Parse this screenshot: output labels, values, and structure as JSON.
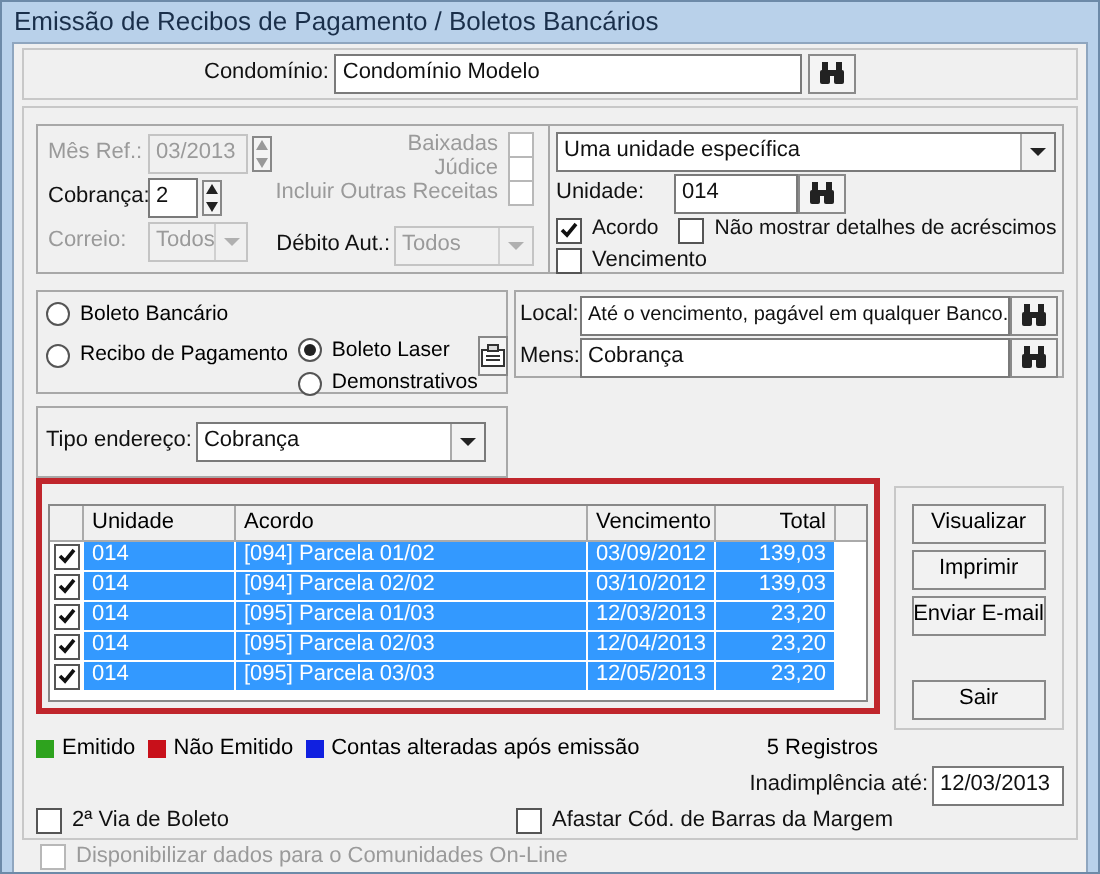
{
  "window": {
    "title": "Emissão de Recibos de Pagamento / Boletos Bancários"
  },
  "condominio": {
    "label": "Condomínio:",
    "value": "Condomínio Modelo"
  },
  "filters": {
    "mes_ref": {
      "label": "Mês Ref.:",
      "value": "03/2013",
      "disabled": true
    },
    "cobranca": {
      "label": "Cobrança:",
      "value": "2",
      "disabled": false
    },
    "correio": {
      "label": "Correio:",
      "value": "Todos",
      "disabled": true
    },
    "checks": [
      {
        "label": "Baixadas",
        "checked": false,
        "disabled": true
      },
      {
        "label": "Júdice",
        "checked": false,
        "disabled": true
      },
      {
        "label": "Incluir Outras Receitas",
        "checked": false,
        "disabled": true
      }
    ],
    "debito": {
      "label": "Débito Aut.:",
      "value": "Todos",
      "disabled": true
    },
    "scope": {
      "value": "Uma unidade específica"
    },
    "unidade": {
      "label": "Unidade:",
      "value": "014"
    },
    "options": [
      {
        "label": "Acordo",
        "checked": true
      },
      {
        "label": "Não mostrar detalhes de acréscimos",
        "checked": false
      },
      {
        "label": "Vencimento",
        "checked": false
      }
    ]
  },
  "doc_types": [
    {
      "label": "Boleto Bancário",
      "selected": false
    },
    {
      "label": "Recibo de Pagamento",
      "selected": false
    },
    {
      "label": "Boleto Laser",
      "selected": true
    },
    {
      "label": "Demonstrativos",
      "selected": false
    }
  ],
  "local": {
    "label": "Local:",
    "value": "Até o vencimento, pagável em qualquer Banco."
  },
  "mens": {
    "label": "Mens:",
    "value": "Cobrança"
  },
  "tipo_endereco": {
    "label": "Tipo endereço:",
    "value": "Cobrança"
  },
  "table": {
    "columns": [
      "Unidade",
      "Acordo",
      "Vencimento",
      "Total"
    ],
    "rows": [
      {
        "checked": true,
        "selected": true,
        "cells": [
          "014",
          "[094] Parcela 01/02",
          "03/09/2012",
          "139,03"
        ]
      },
      {
        "checked": true,
        "selected": true,
        "cells": [
          "014",
          "[094] Parcela 02/02",
          "03/10/2012",
          "139,03"
        ]
      },
      {
        "checked": true,
        "selected": true,
        "cells": [
          "014",
          "[095] Parcela 01/03",
          "12/03/2013",
          "23,20"
        ]
      },
      {
        "checked": true,
        "selected": true,
        "cells": [
          "014",
          "[095] Parcela 02/03",
          "12/04/2013",
          "23,20"
        ]
      },
      {
        "checked": true,
        "selected": true,
        "cells": [
          "014",
          "[095] Parcela 03/03",
          "12/05/2013",
          "23,20"
        ]
      }
    ]
  },
  "buttons": [
    "Visualizar",
    "Imprimir",
    "Enviar E-mail",
    "Sair"
  ],
  "legend": [
    {
      "label": "Emitido",
      "color": "#2ea31e"
    },
    {
      "label": "Não Emitido",
      "color": "#c8101a"
    },
    {
      "label": "Contas alteradas após emissão",
      "color": "#1020e0"
    }
  ],
  "record_count": "5 Registros",
  "inadimplencia": {
    "label": "Inadimplência até:",
    "value": "12/03/2013"
  },
  "bottom_checks": [
    {
      "label": "2ª Via de Boleto",
      "checked": false,
      "disabled": false
    },
    {
      "label": "Afastar Cód. de Barras da Margem",
      "checked": false,
      "disabled": false
    },
    {
      "label": "Disponibilizar dados para o Comunidades On-Line",
      "checked": false,
      "disabled": true
    }
  ]
}
